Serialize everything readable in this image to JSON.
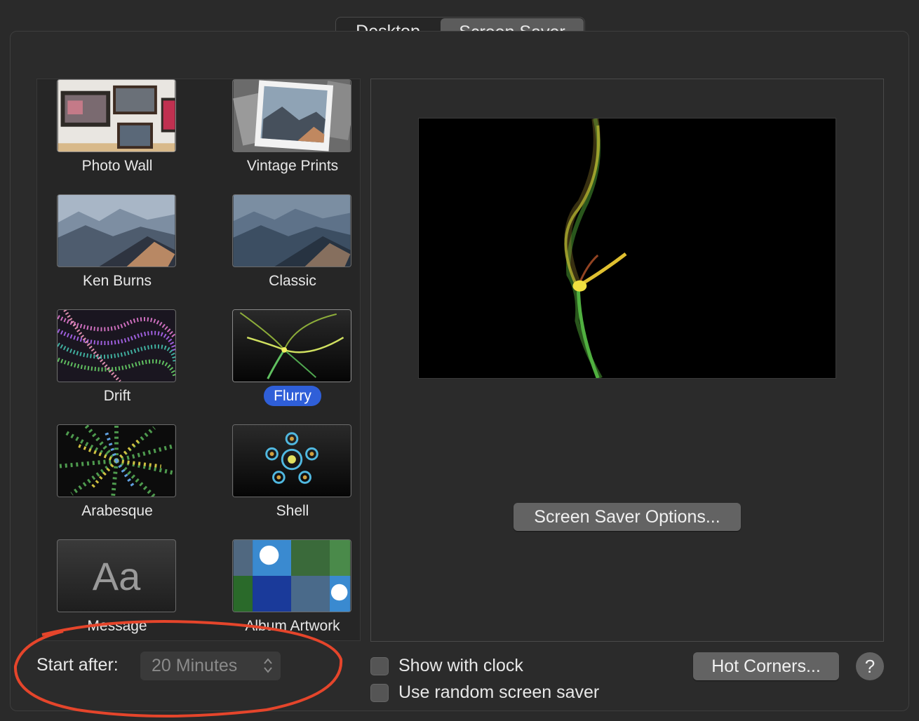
{
  "tabs": [
    {
      "label": "Desktop",
      "selected": false
    },
    {
      "label": "Screen Saver",
      "selected": true
    }
  ],
  "screensavers": [
    {
      "label": "Photo Wall",
      "selected": false
    },
    {
      "label": "Vintage Prints",
      "selected": false
    },
    {
      "label": "Ken Burns",
      "selected": false
    },
    {
      "label": "Classic",
      "selected": false
    },
    {
      "label": "Drift",
      "selected": false
    },
    {
      "label": "Flurry",
      "selected": true
    },
    {
      "label": "Arabesque",
      "selected": false
    },
    {
      "label": "Shell",
      "selected": false
    },
    {
      "label": "Message",
      "selected": false,
      "thumb_text": "Aa"
    },
    {
      "label": "Album Artwork",
      "selected": false
    }
  ],
  "options_button": "Screen Saver Options...",
  "start_after": {
    "label": "Start after:",
    "value": "20 Minutes"
  },
  "checkboxes": [
    {
      "label": "Show with clock",
      "checked": false
    },
    {
      "label": "Use random screen saver",
      "checked": false
    }
  ],
  "hot_corners_button": "Hot Corners...",
  "help_button": "?",
  "colors": {
    "selection": "#2f5fd8",
    "annotation": "#e5452b"
  }
}
